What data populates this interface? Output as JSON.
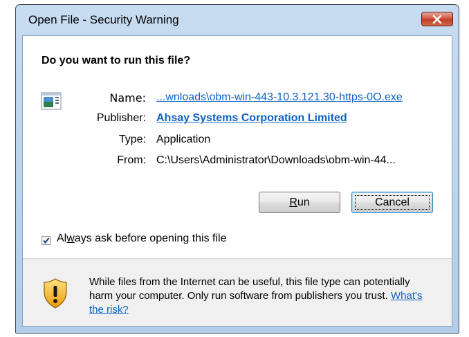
{
  "window": {
    "title": "Open File - Security Warning"
  },
  "dialog": {
    "heading": "Do you want to run this file?",
    "file_icon": "application-file-icon",
    "fields": {
      "name_label": "Name:",
      "name_value": "...wnloads\\obm-win-443-10.3.121.30-https-0O.exe",
      "publisher_label": "Publisher:",
      "publisher_value": "Ahsay Systems Corporation Limited",
      "type_label": "Type:",
      "type_value": "Application",
      "from_label": "From:",
      "from_value": "C:\\Users\\Administrator\\Downloads\\obm-win-44..."
    },
    "buttons": {
      "run_prefix": "",
      "run_accel": "R",
      "run_rest": "un",
      "cancel": "Cancel"
    },
    "checkbox": {
      "checked": true,
      "label_prefix": "Al",
      "label_accel": "w",
      "label_rest": "ays ask before opening this file"
    },
    "warning": {
      "icon": "shield-warning-icon",
      "text": "While files from the Internet can be useful, this file type can potentially harm your computer. Only run software from publishers you trust.",
      "link": "What's the risk?"
    }
  },
  "colors": {
    "link": "#0e61c4",
    "close_button": "#c23a22",
    "title_bar": "#b3cde8"
  }
}
